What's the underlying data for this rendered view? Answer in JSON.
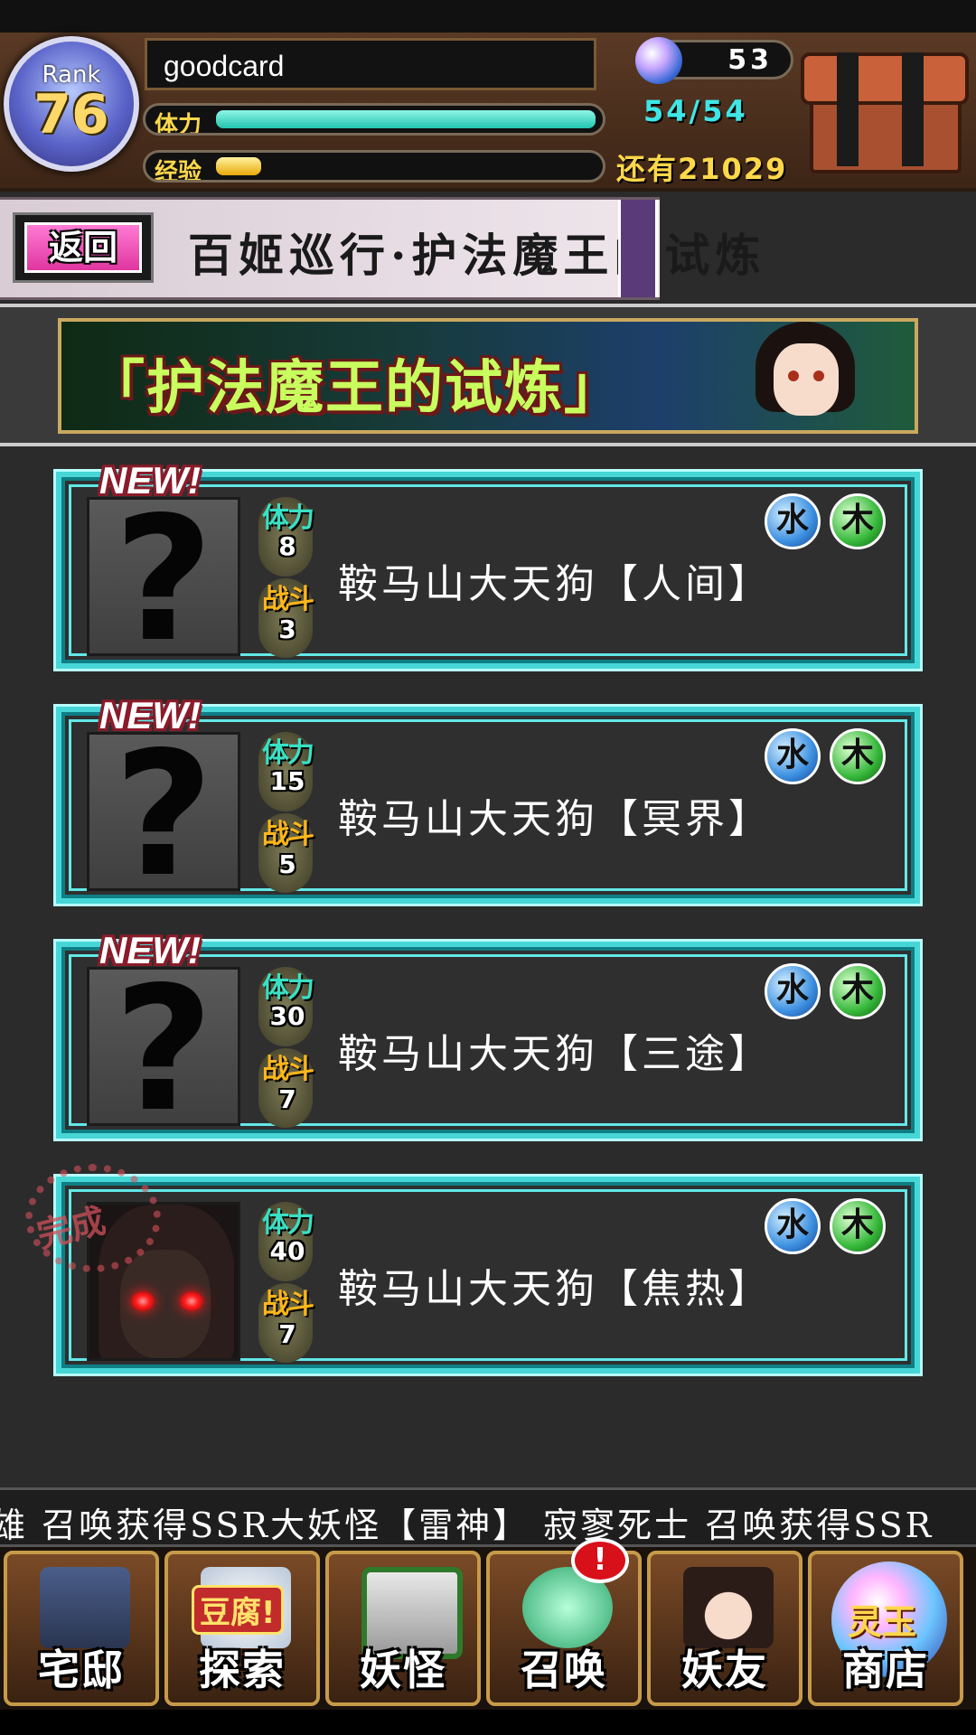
{
  "player": {
    "rank_label": "Rank",
    "rank_value": "76",
    "name": "goodcard",
    "stamina_label": "体力",
    "stamina_value": "54/54",
    "stamina_fraction": 1.0,
    "exp_label": "经验",
    "exp_fraction": 0.12,
    "orb_count": "53",
    "remaining_text": "还有21029"
  },
  "nav_header": {
    "back_label": "返回",
    "title": "百姬巡行·护法魔王的试炼"
  },
  "banner": {
    "text": "「护法魔王的试炼」"
  },
  "quests": [
    {
      "new": "NEW!",
      "stamina_label": "体力",
      "stamina": "8",
      "battle_label": "战斗",
      "battles": "3",
      "name": "鞍马山大天狗【人间】",
      "elements": [
        "water-element-icon",
        "wood-element-icon"
      ],
      "completed": false
    },
    {
      "new": "NEW!",
      "stamina_label": "体力",
      "stamina": "15",
      "battle_label": "战斗",
      "battles": "5",
      "name": "鞍马山大天狗【冥界】",
      "elements": [
        "water-element-icon",
        "wood-element-icon"
      ],
      "completed": false
    },
    {
      "new": "NEW!",
      "stamina_label": "体力",
      "stamina": "30",
      "battle_label": "战斗",
      "battles": "7",
      "name": "鞍马山大天狗【三途】",
      "elements": [
        "water-element-icon",
        "wood-element-icon"
      ],
      "completed": false
    },
    {
      "new": "",
      "stamina_label": "体力",
      "stamina": "40",
      "battle_label": "战斗",
      "battles": "7",
      "name": "鞍马山大天狗【焦热】",
      "elements": [
        "water-element-icon",
        "wood-element-icon"
      ],
      "completed": true,
      "stamp": "完成"
    }
  ],
  "element_glyphs": {
    "water": "水",
    "wood": "木"
  },
  "ticker": "雄 召唤获得SSR大妖怪【雷神】    寂寥死士 召唤获得SSR",
  "bottom_nav": [
    {
      "label": "宅邸",
      "icon": "house-icon"
    },
    {
      "label": "探索",
      "icon": "tofu-explore-icon",
      "badge": "豆腐!"
    },
    {
      "label": "妖怪",
      "icon": "monster-scroll-icon"
    },
    {
      "label": "召唤",
      "icon": "pentagram-summon-icon",
      "alert": "!"
    },
    {
      "label": "妖友",
      "icon": "cat-girl-friend-icon"
    },
    {
      "label": "商店",
      "icon": "spirit-orb-shop-icon",
      "badge": "灵玉"
    }
  ],
  "colors": {
    "accent_cyan": "#47d6d6",
    "stamina_text": "#3fe6e6",
    "gold_text": "#ffd84a",
    "back_button": "#e0369f"
  }
}
